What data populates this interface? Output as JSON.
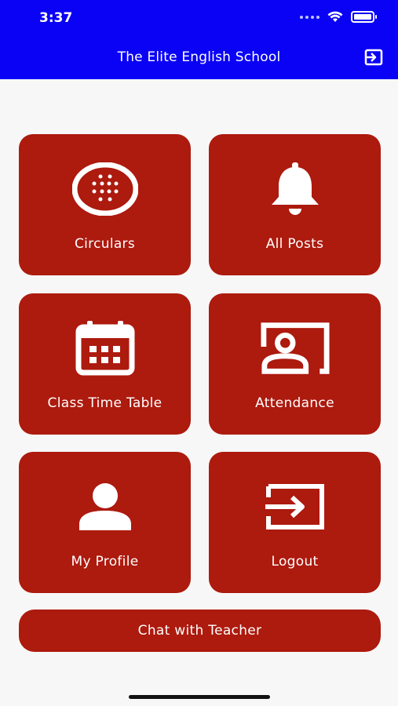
{
  "status_bar": {
    "time": "3:37"
  },
  "header": {
    "title": "The Elite English School",
    "logout_icon": "logout-icon"
  },
  "tiles": [
    {
      "label": "Circulars",
      "icon": "circular-dots-icon"
    },
    {
      "label": "All Posts",
      "icon": "bell-icon"
    },
    {
      "label": "Class Time Table",
      "icon": "calendar-icon"
    },
    {
      "label": "Attendance",
      "icon": "attendance-board-icon"
    },
    {
      "label": "My Profile",
      "icon": "person-icon"
    },
    {
      "label": "Logout",
      "icon": "logout-icon"
    }
  ],
  "chat_button": {
    "label": "Chat with Teacher"
  },
  "colors": {
    "header_bg": "#0a02f5",
    "tile_bg": "#ad1a0e",
    "page_bg": "#f7f7f7"
  }
}
